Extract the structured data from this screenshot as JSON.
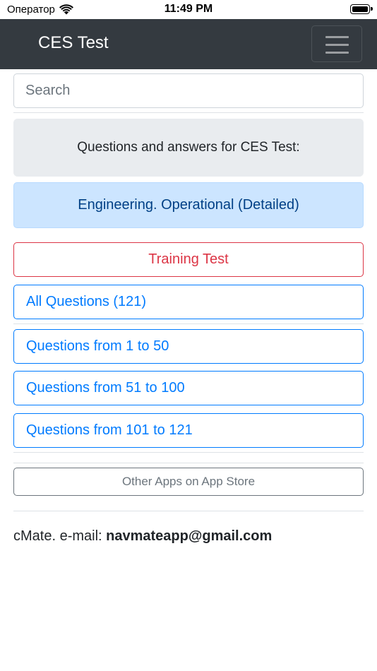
{
  "status_bar": {
    "carrier": "Оператор",
    "time": "11:49 PM"
  },
  "navbar": {
    "title": "CES Test"
  },
  "search": {
    "placeholder": "Search"
  },
  "intro": "Questions and answers for CES Test:",
  "category": "Engineering. Operational (Detailed)",
  "buttons": {
    "training": "Training Test",
    "all": "All Questions (121)",
    "range1": "Questions from 1 to 50",
    "range2": "Questions from 51 to 100",
    "range3": "Questions from 101 to 121",
    "other_apps": "Other Apps on App Store"
  },
  "footer": {
    "prefix": "cMate. e-mail: ",
    "email": "navmateapp@gmail.com"
  },
  "colors": {
    "navbar": "#343a40",
    "primary": "#007bff",
    "danger": "#dc3545",
    "secondary": "#6c757d",
    "info_bg": "#cce5ff"
  },
  "icons": [
    "wifi-icon",
    "battery-icon",
    "hamburger-menu-icon"
  ]
}
